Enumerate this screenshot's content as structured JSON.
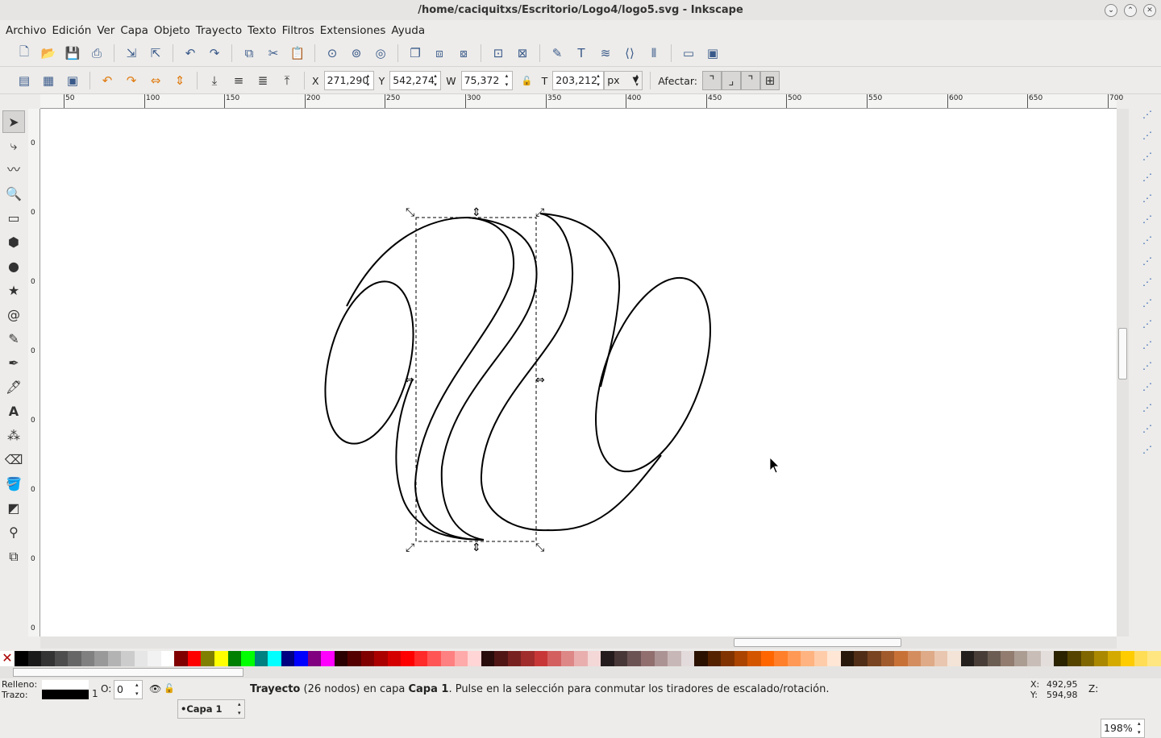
{
  "window": {
    "title": "/home/caciquitxs/Escritorio/Logo4/logo5.svg - Inkscape"
  },
  "menu": [
    "Archivo",
    "Edición",
    "Ver",
    "Capa",
    "Objeto",
    "Trayecto",
    "Texto",
    "Filtros",
    "Extensiones",
    "Ayuda"
  ],
  "toolbar_icons": [
    "new-icon",
    "open-icon",
    "save-icon",
    "print-icon",
    "import-icon",
    "export-icon",
    "undo-icon",
    "redo-icon",
    "copy-icon",
    "cut-icon",
    "paste-icon",
    "zoom-selection-icon",
    "zoom-drawing-icon",
    "zoom-page-icon",
    "duplicate-icon",
    "clone-icon",
    "unlink-clone-icon",
    "group-icon",
    "ungroup-icon",
    "fill-stroke-icon",
    "text-font-icon",
    "layers-icon",
    "xml-editor-icon",
    "align-icon",
    "preferences-icon",
    "document-properties-icon"
  ],
  "select_controls": {
    "x_label": "X",
    "x": "271,290",
    "y_label": "Y",
    "y": "542,274",
    "w_label": "W",
    "w": "75,372",
    "h_label": "T",
    "h": "203,212",
    "unit": "px",
    "affect_label": "Afectar:"
  },
  "ruler_top": [
    "50",
    "100",
    "150",
    "200",
    "250",
    "300",
    "350",
    "400",
    "450",
    "500",
    "550",
    "600",
    "650",
    "700"
  ],
  "ruler_left": [
    "0",
    "0",
    "0",
    "0",
    "0",
    "0",
    "0",
    "0"
  ],
  "tools": [
    "selector",
    "node",
    "tweak",
    "zoom",
    "rectangle",
    "3d-box",
    "ellipse",
    "star",
    "spiral",
    "pencil",
    "pen",
    "calligraphy",
    "text",
    "spray",
    "eraser",
    "paint-bucket",
    "gradient",
    "dropper",
    "connector"
  ],
  "palette": [
    "#000000",
    "#1a1a1a",
    "#333333",
    "#4d4d4d",
    "#666666",
    "#808080",
    "#999999",
    "#b3b3b3",
    "#cccccc",
    "#e6e6e6",
    "#f2f2f2",
    "#ffffff",
    "#800000",
    "#ff0000",
    "#808000",
    "#ffff00",
    "#008000",
    "#00ff00",
    "#008080",
    "#00ffff",
    "#000080",
    "#0000ff",
    "#800080",
    "#ff00ff",
    "#2b0000",
    "#550000",
    "#800000",
    "#aa0000",
    "#d40000",
    "#ff0000",
    "#ff2a2a",
    "#ff5555",
    "#ff8080",
    "#ffaaaa",
    "#ffd5d5",
    "#280b0b",
    "#501616",
    "#782121",
    "#a02c2c",
    "#c83737",
    "#d35f5f",
    "#de8787",
    "#e9afaf",
    "#f4d7d7",
    "#241c1c",
    "#483737",
    "#6c5353",
    "#916f6f",
    "#ac9393",
    "#c8b7b7",
    "#e3dbdb",
    "#2b1100",
    "#552200",
    "#803300",
    "#aa4400",
    "#d45500",
    "#ff6600",
    "#ff7f2a",
    "#ff9955",
    "#ffb380",
    "#ffccaa",
    "#ffe6d5",
    "#28170b",
    "#502d16",
    "#784421",
    "#a05a2c",
    "#c87137",
    "#d38d5f",
    "#deaa87",
    "#e9c6af",
    "#f4e3d7",
    "#241f1c",
    "#483e37",
    "#6c5d53",
    "#917c6f",
    "#ac9d93",
    "#c8beb7",
    "#e3dedb",
    "#2b2200",
    "#554400",
    "#806600",
    "#aa8800",
    "#d4aa00",
    "#ffcc00",
    "#ffdd55",
    "#ffe680"
  ],
  "status": {
    "fill_label": "Relleno:",
    "stroke_label": "Trazo:",
    "stroke_width": "1",
    "opacity_label": "O:",
    "opacity": "0",
    "layer": "•Capa 1",
    "message_bold1": "Trayecto",
    "message_part1": " (26 nodos) en capa ",
    "message_bold2": "Capa 1",
    "message_part2": ". Pulse en la selección para conmutar los tiradores de escalado/rotación.",
    "x_label": "X:",
    "x": "492,95",
    "y_label": "Y:",
    "y": "594,98",
    "zoom_label": "Z:",
    "zoom": "198%"
  },
  "colors": {
    "fill": "#ffffff",
    "stroke": "#000000"
  }
}
